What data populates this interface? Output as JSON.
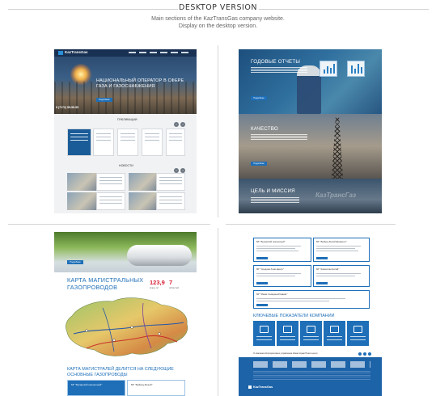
{
  "header": {
    "title": "DESKTOP VERSION",
    "subtitle_line1": "Main sections of the KazTransGas company website.",
    "subtitle_line2": "Display on the desktop version."
  },
  "home": {
    "logo_text": "KazTransGas",
    "hero_title": "НАЦИОНАЛЬНЫЙ ОПЕРАТОР В СФЕРЕ ГАЗА И ГАЗОСНАБЖЕНИЯ",
    "hero_button": "Подробнее",
    "phone": "8 (7172) 55-55-55",
    "publications_title": "ПУБЛИКАЦИИ",
    "news_title": "НОВОСТИ"
  },
  "reports": {
    "title1": "ГОДОВЫЕ ОТЧЕТЫ",
    "title2": "КАЧЕСТВО",
    "title3": "ЦЕЛЬ И МИССИЯ",
    "button": "Подробнее",
    "watermark": "КазТрансГаз"
  },
  "map_section": {
    "top_button": "Подробнее",
    "title": "КАРТА МАГИСТРАЛЬНЫХ ГАЗОПРОВОДОВ",
    "stat1_value": "123,9",
    "stat1_label": "млрд. м³",
    "stat2_value": "7",
    "stat2_label": "областей",
    "subtitle": "КАРТА МАГИСТРАЛЕЙ ДЕЛИТСЯ НА СЛЕДУЮЩИЕ ОСНОВНЫЕ ГАЗОПРОВОДЫ",
    "card1": "МГ \"Бухарский газоносный\"",
    "card2": "МГ \"Бейнеу-Бозой\""
  },
  "pipelines": {
    "cards": [
      "МГ \"Бухарский газоносный\"",
      "МГ \"Бейнеу-Бозой-Шымкент\"",
      "МГ \"Средняя Азия-Центр\"",
      "МГ \"Казахстан-Китай\"",
      "МГ \"Макат-Северный Кавказ\""
    ],
    "indicators_title": "КЛЮЧЕВЫЕ ПОКАЗАТЕЛИ КОМПАНИИ",
    "footer_nav": "О компании   Корпоративное управление   Инвесторам   Пресс-центр",
    "footer_logo": "KazTransGas"
  },
  "colors": {
    "brand_blue": "#1e6fb8",
    "accent_red": "#d6233a"
  }
}
